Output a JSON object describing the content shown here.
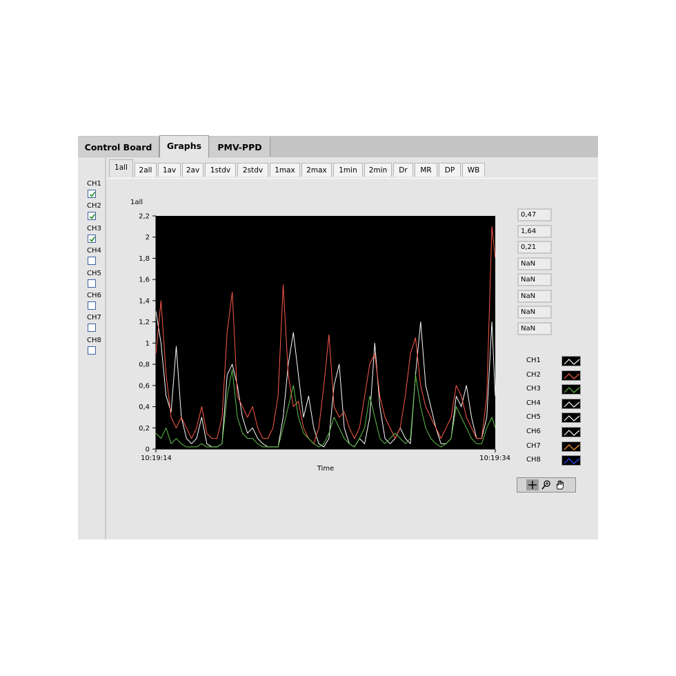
{
  "main_tabs": [
    {
      "label": "Control Board",
      "active": false
    },
    {
      "label": "Graphs",
      "active": true
    },
    {
      "label": "PMV-PPD",
      "active": false
    }
  ],
  "sub_tabs": [
    {
      "label": "1all",
      "active": true
    },
    {
      "label": "2all"
    },
    {
      "label": "1av"
    },
    {
      "label": "2av"
    },
    {
      "label": "1stdv"
    },
    {
      "label": "2stdv"
    },
    {
      "label": "1max"
    },
    {
      "label": "2max"
    },
    {
      "label": "1min"
    },
    {
      "label": "2min"
    },
    {
      "label": "Dr"
    },
    {
      "label": "MR"
    },
    {
      "label": "DP"
    },
    {
      "label": "WB"
    }
  ],
  "channels": [
    {
      "label": "CH1",
      "checked": true
    },
    {
      "label": "CH2",
      "checked": true
    },
    {
      "label": "CH3",
      "checked": true
    },
    {
      "label": "CH4",
      "checked": false
    },
    {
      "label": "CH5",
      "checked": false
    },
    {
      "label": "CH6",
      "checked": false
    },
    {
      "label": "CH7",
      "checked": false
    },
    {
      "label": "CH8",
      "checked": false
    }
  ],
  "values": [
    "0,47",
    "1,64",
    "0,21",
    "NaN",
    "NaN",
    "NaN",
    "NaN",
    "NaN"
  ],
  "legend": [
    {
      "label": "CH1",
      "color": "#ffffff"
    },
    {
      "label": "CH2",
      "color": "#ff5a4a"
    },
    {
      "label": "CH3",
      "color": "#5fbf4a"
    },
    {
      "label": "CH4",
      "color": "#ffffff"
    },
    {
      "label": "CH5",
      "color": "#ffffff"
    },
    {
      "label": "CH6",
      "color": "#ffffff"
    },
    {
      "label": "CH7",
      "color": "#ffa030"
    },
    {
      "label": "CH8",
      "color": "#3050ff"
    }
  ],
  "palette_icons": [
    "crosshair-icon",
    "zoom-icon",
    "hand-icon"
  ],
  "chart_data": {
    "type": "line",
    "title": "1all",
    "xlabel": "Time",
    "ylabel": "",
    "x_tick_labels": [
      "10:19:14",
      "10:19:34"
    ],
    "y_ticks": [
      "0",
      "0,2",
      "0,4",
      "0,6",
      "0,8",
      "1",
      "1,2",
      "1,4",
      "1,6",
      "1,8",
      "2",
      "2,2"
    ],
    "xlim": [
      0,
      20
    ],
    "ylim": [
      0,
      2.2
    ],
    "grid": false,
    "background": "#000000",
    "series": [
      {
        "name": "CH1",
        "color": "#ffffff",
        "x": [
          0,
          0.3,
          0.6,
          0.9,
          1.2,
          1.5,
          1.8,
          2.1,
          2.4,
          2.7,
          3.0,
          3.3,
          3.6,
          3.9,
          4.2,
          4.5,
          4.8,
          5.1,
          5.4,
          5.7,
          6.0,
          6.3,
          6.6,
          6.9,
          7.2,
          7.5,
          7.8,
          8.1,
          8.4,
          8.7,
          9.0,
          9.3,
          9.6,
          9.9,
          10.2,
          10.5,
          10.8,
          11.1,
          11.4,
          11.7,
          12.0,
          12.3,
          12.6,
          12.9,
          13.2,
          13.5,
          13.8,
          14.1,
          14.4,
          14.7,
          15.0,
          15.3,
          15.6,
          15.9,
          16.2,
          16.5,
          16.8,
          17.1,
          17.4,
          17.7,
          18.0,
          18.3,
          18.6,
          18.9,
          19.2,
          19.5,
          19.8,
          20.0
        ],
        "y": [
          1.3,
          1.0,
          0.5,
          0.35,
          0.97,
          0.3,
          0.1,
          0.05,
          0.1,
          0.3,
          0.05,
          0.02,
          0.02,
          0.05,
          0.7,
          0.8,
          0.6,
          0.3,
          0.15,
          0.2,
          0.1,
          0.05,
          0.02,
          0.02,
          0.02,
          0.3,
          0.8,
          1.1,
          0.7,
          0.3,
          0.5,
          0.2,
          0.05,
          0.02,
          0.1,
          0.6,
          0.8,
          0.2,
          0.05,
          0.02,
          0.1,
          0.05,
          0.3,
          1.0,
          0.4,
          0.1,
          0.05,
          0.1,
          0.2,
          0.1,
          0.05,
          0.7,
          1.2,
          0.6,
          0.4,
          0.2,
          0.05,
          0.05,
          0.1,
          0.5,
          0.4,
          0.6,
          0.3,
          0.1,
          0.1,
          0.3,
          1.2,
          0.5
        ]
      },
      {
        "name": "CH2",
        "color": "#ff5a4a",
        "x": [
          0,
          0.3,
          0.6,
          0.9,
          1.2,
          1.5,
          1.8,
          2.1,
          2.4,
          2.7,
          3.0,
          3.3,
          3.6,
          3.9,
          4.2,
          4.5,
          4.8,
          5.1,
          5.4,
          5.7,
          6.0,
          6.3,
          6.6,
          6.9,
          7.2,
          7.5,
          7.8,
          8.1,
          8.4,
          8.7,
          9.0,
          9.3,
          9.6,
          9.9,
          10.2,
          10.5,
          10.8,
          11.1,
          11.4,
          11.7,
          12.0,
          12.3,
          12.6,
          12.9,
          13.2,
          13.5,
          13.8,
          14.1,
          14.4,
          14.7,
          15.0,
          15.3,
          15.6,
          15.9,
          16.2,
          16.5,
          16.8,
          17.1,
          17.4,
          17.7,
          18.0,
          18.3,
          18.6,
          18.9,
          19.2,
          19.5,
          19.8,
          20.0
        ],
        "y": [
          0.9,
          1.4,
          0.7,
          0.3,
          0.2,
          0.3,
          0.2,
          0.1,
          0.2,
          0.4,
          0.15,
          0.1,
          0.1,
          0.3,
          1.1,
          1.48,
          0.5,
          0.4,
          0.3,
          0.4,
          0.2,
          0.1,
          0.1,
          0.2,
          0.5,
          1.55,
          0.7,
          0.4,
          0.45,
          0.2,
          0.1,
          0.05,
          0.2,
          0.6,
          1.08,
          0.4,
          0.3,
          0.35,
          0.2,
          0.1,
          0.2,
          0.5,
          0.8,
          0.9,
          0.5,
          0.3,
          0.2,
          0.1,
          0.2,
          0.5,
          0.9,
          1.05,
          0.6,
          0.4,
          0.3,
          0.2,
          0.1,
          0.2,
          0.3,
          0.6,
          0.5,
          0.3,
          0.2,
          0.1,
          0.1,
          0.5,
          2.1,
          1.8
        ]
      },
      {
        "name": "CH3",
        "color": "#5fbf4a",
        "x": [
          0,
          0.3,
          0.6,
          0.9,
          1.2,
          1.5,
          1.8,
          2.1,
          2.4,
          2.7,
          3.0,
          3.3,
          3.6,
          3.9,
          4.2,
          4.5,
          4.8,
          5.1,
          5.4,
          5.7,
          6.0,
          6.3,
          6.6,
          6.9,
          7.2,
          7.5,
          7.8,
          8.1,
          8.4,
          8.7,
          9.0,
          9.3,
          9.6,
          9.9,
          10.2,
          10.5,
          10.8,
          11.1,
          11.4,
          11.7,
          12.0,
          12.3,
          12.6,
          12.9,
          13.2,
          13.5,
          13.8,
          14.1,
          14.4,
          14.7,
          15.0,
          15.3,
          15.6,
          15.9,
          16.2,
          16.5,
          16.8,
          17.1,
          17.4,
          17.7,
          18.0,
          18.3,
          18.6,
          18.9,
          19.2,
          19.5,
          19.8,
          20.0
        ],
        "y": [
          0.15,
          0.1,
          0.2,
          0.05,
          0.1,
          0.05,
          0.02,
          0.02,
          0.02,
          0.05,
          0.02,
          0.02,
          0.02,
          0.05,
          0.5,
          0.75,
          0.3,
          0.15,
          0.1,
          0.1,
          0.05,
          0.02,
          0.02,
          0.02,
          0.02,
          0.2,
          0.4,
          0.6,
          0.3,
          0.15,
          0.1,
          0.05,
          0.02,
          0.05,
          0.15,
          0.3,
          0.2,
          0.1,
          0.05,
          0.02,
          0.1,
          0.2,
          0.5,
          0.3,
          0.1,
          0.05,
          0.1,
          0.15,
          0.1,
          0.05,
          0.1,
          0.7,
          0.4,
          0.2,
          0.1,
          0.05,
          0.02,
          0.05,
          0.1,
          0.4,
          0.3,
          0.2,
          0.1,
          0.05,
          0.05,
          0.2,
          0.3,
          0.2
        ]
      }
    ]
  }
}
